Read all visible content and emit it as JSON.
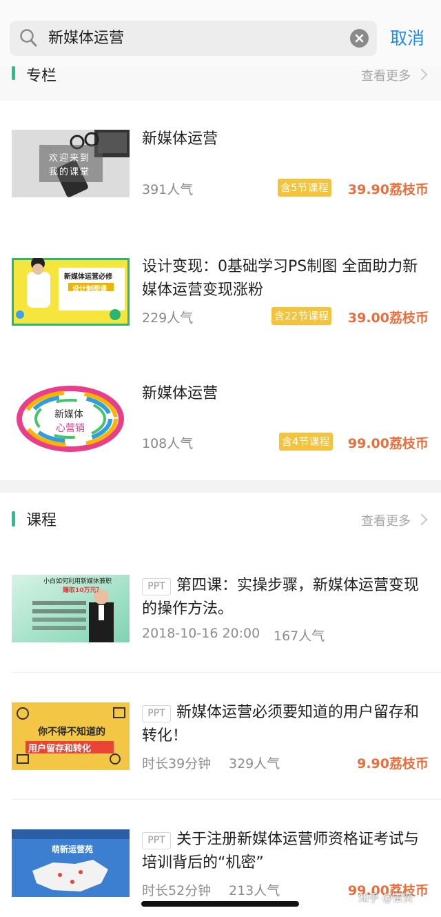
{
  "search": {
    "query": "新媒体运营",
    "cancel_label": "取消"
  },
  "column_section": {
    "title": "专栏",
    "view_more": "查看更多",
    "items": [
      {
        "title": "新媒体运营",
        "popularity": "391人气",
        "lessons": "含5节课程",
        "price": "39.90荔枝币",
        "thumb_text": [
          "欢迎来到",
          "我的课堂"
        ]
      },
      {
        "title": "设计变现：0基础学习PS制图 全面助力新媒体运营变现涨粉",
        "popularity": "229人气",
        "lessons": "含22节课程",
        "price": "39.00荔枝币",
        "thumb_text": [
          "新媒体运营必修",
          "设计制图课"
        ]
      },
      {
        "title": "新媒体运营",
        "popularity": "108人气",
        "lessons": "含4节课程",
        "price": "99.00荔枝币",
        "thumb_text": [
          "新媒体",
          "心营销"
        ]
      }
    ]
  },
  "course_section": {
    "title": "课程",
    "view_more": "查看更多",
    "items": [
      {
        "tag": "PPT",
        "title": "第四课：实操步骤，新媒体运营变现的操作方法。",
        "meta_left": "2018-10-16 20:00",
        "meta_right": "167人气",
        "price": "",
        "thumb_text": [
          "小白如何利用新媒体兼职",
          "赚取10万元？"
        ]
      },
      {
        "tag": "PPT",
        "title": "新媒体运营必须要知道的用户留存和转化！",
        "meta_left": "时长39分钟",
        "meta_right": "329人气",
        "price": "9.90荔枝币",
        "thumb_text": [
          "你不得不知道的",
          "用户留存和转化"
        ]
      },
      {
        "tag": "PPT",
        "title": "关于注册新媒体运营师资格证考试与培训背后的“机密”",
        "meta_left": "时长52分钟",
        "meta_right": "213人气",
        "price": "99.00荔枝币",
        "thumb_text": [
          "萌新运营苑"
        ]
      }
    ]
  },
  "watermark": "知乎 @雷荧",
  "colors": {
    "accent": "#2ac08a",
    "price": "#ea6e3b",
    "badge": "#f5c33b",
    "link": "#1f8cf0"
  }
}
